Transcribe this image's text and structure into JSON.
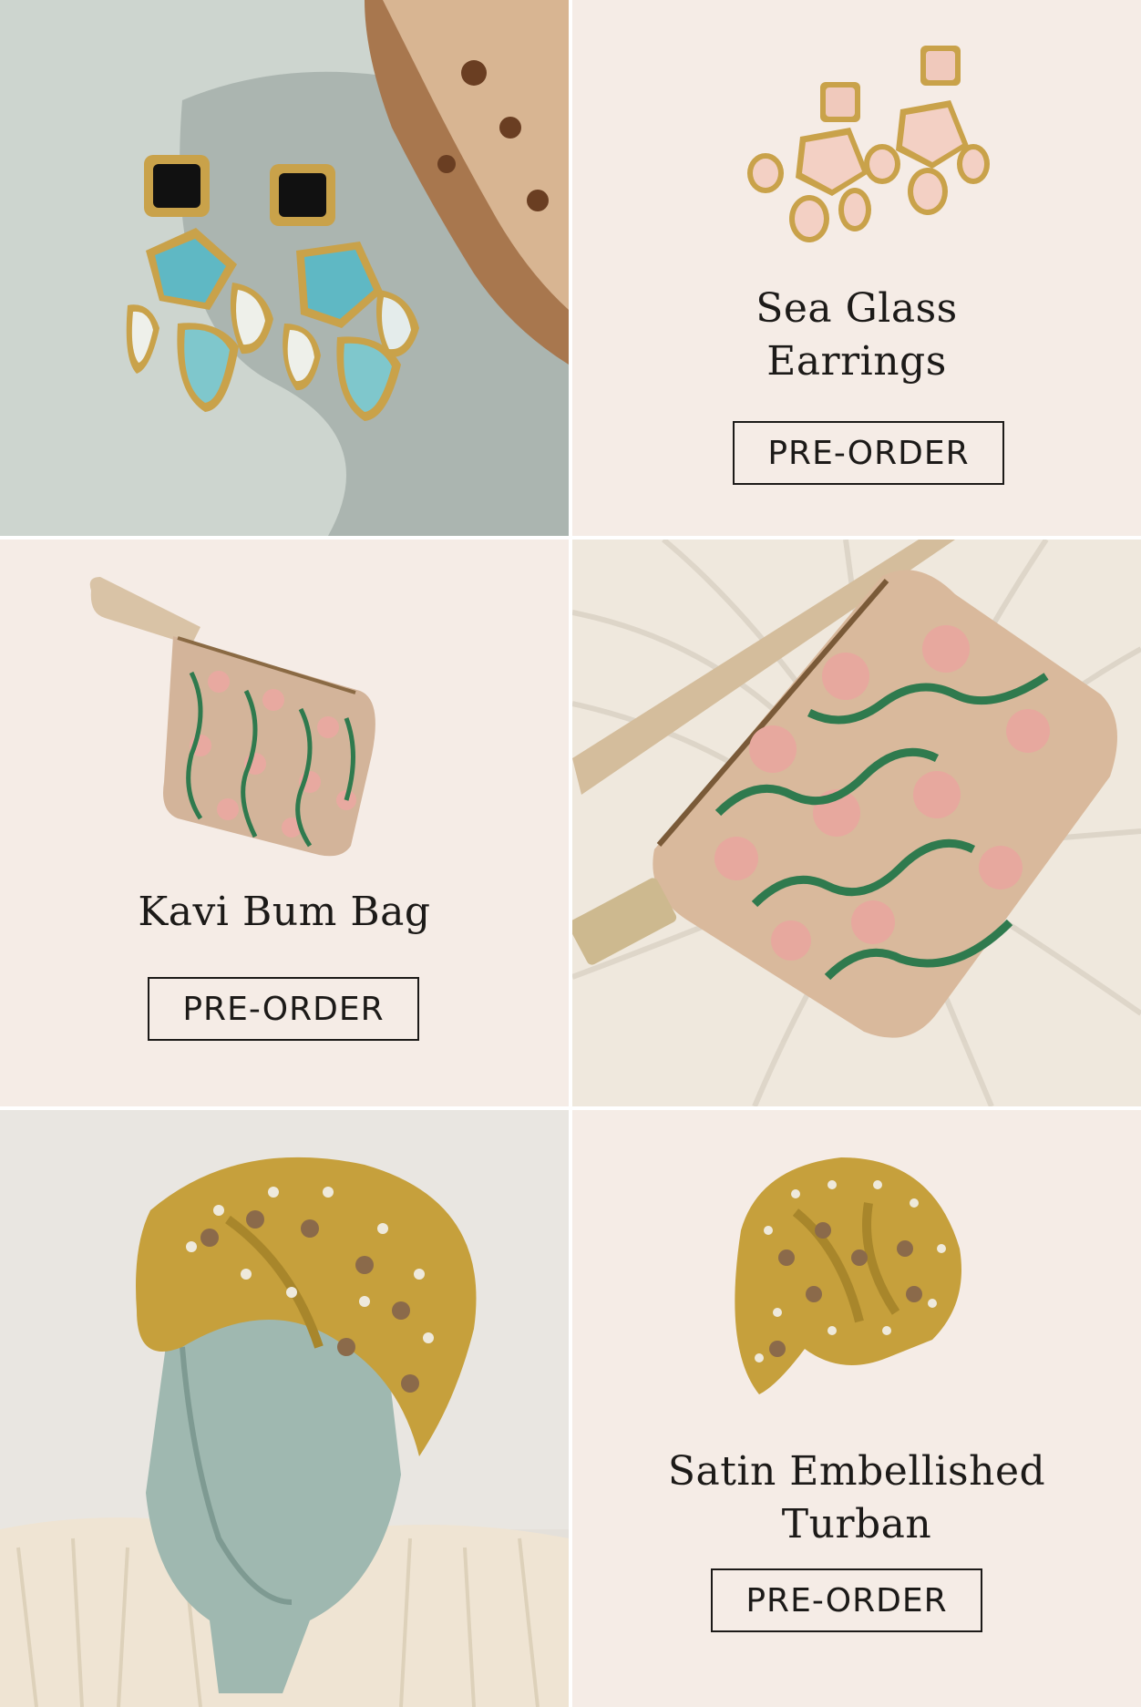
{
  "products": [
    {
      "title_lines": [
        "Sea Glass",
        "Earrings"
      ],
      "button": "PRE-ORDER"
    },
    {
      "title_lines": [
        "Kavi Bum Bag"
      ],
      "button": "PRE-ORDER"
    },
    {
      "title_lines": [
        "Satin Embellished",
        "Turban"
      ],
      "button": "PRE-ORDER"
    }
  ],
  "colors": {
    "background": "#f5ece6",
    "text": "#1c1a18",
    "gold": "#c9a24a",
    "aqua": "#5fb8c4",
    "rose": "#e8b9a8",
    "green": "#2f7a4e"
  }
}
